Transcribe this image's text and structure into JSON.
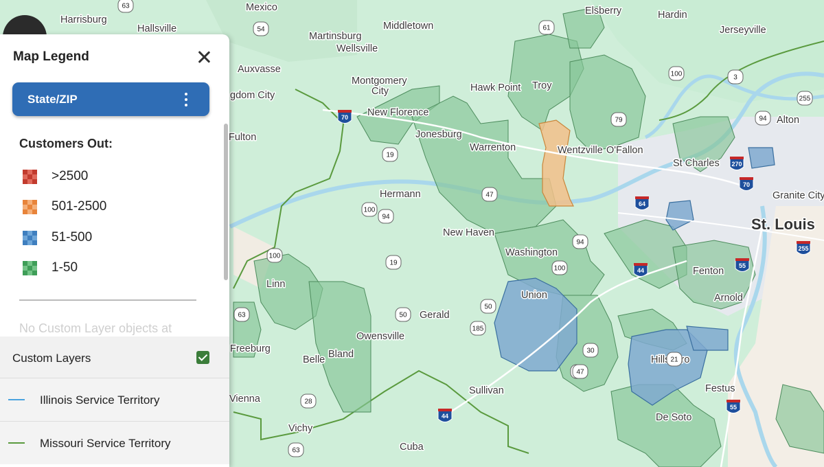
{
  "map": {
    "places": [
      {
        "name": "Harrisburg"
      },
      {
        "name": "Hallsville"
      },
      {
        "name": "Mexico"
      },
      {
        "name": "Middletown"
      },
      {
        "name": "Elsberry"
      },
      {
        "name": "Hardin"
      },
      {
        "name": "Jerseyville"
      },
      {
        "name": "Martinsburg"
      },
      {
        "name": "Wellsville"
      },
      {
        "name": "Auxvasse"
      },
      {
        "name": "Montgomery"
      },
      {
        "name": "City"
      },
      {
        "name": "Hawk Point"
      },
      {
        "name": "Troy"
      },
      {
        "name": "gdom City"
      },
      {
        "name": "New Florence"
      },
      {
        "name": "Jonesburg"
      },
      {
        "name": "Warrenton"
      },
      {
        "name": "Wentzville"
      },
      {
        "name": "O'Fallon"
      },
      {
        "name": "Alton"
      },
      {
        "name": "Fulton"
      },
      {
        "name": "St Charles"
      },
      {
        "name": "Hermann"
      },
      {
        "name": "Granite City"
      },
      {
        "name": "New Haven"
      },
      {
        "name": "St. Louis"
      },
      {
        "name": "Washington"
      },
      {
        "name": "Linn"
      },
      {
        "name": "Fenton"
      },
      {
        "name": "Union"
      },
      {
        "name": "Arnold"
      },
      {
        "name": "Gerald"
      },
      {
        "name": "Owensville"
      },
      {
        "name": "Freeburg"
      },
      {
        "name": "Belle"
      },
      {
        "name": "Bland"
      },
      {
        "name": "Hillsboro"
      },
      {
        "name": "Sullivan"
      },
      {
        "name": "Festus"
      },
      {
        "name": "Vienna"
      },
      {
        "name": "De Soto"
      },
      {
        "name": "Vichy"
      },
      {
        "name": "Cuba"
      }
    ],
    "shields": [
      {
        "num": "63"
      },
      {
        "num": "54"
      },
      {
        "num": "61"
      },
      {
        "num": "79"
      },
      {
        "num": "100"
      },
      {
        "num": "3"
      },
      {
        "num": "255"
      },
      {
        "num": "19"
      },
      {
        "num": "94"
      },
      {
        "num": "47"
      },
      {
        "num": "100"
      },
      {
        "num": "94"
      },
      {
        "num": "100"
      },
      {
        "num": "19"
      },
      {
        "num": "100"
      },
      {
        "num": "63"
      },
      {
        "num": "50"
      },
      {
        "num": "50"
      },
      {
        "num": "185"
      },
      {
        "num": "30"
      },
      {
        "num": "47"
      },
      {
        "num": "21"
      },
      {
        "num": "28"
      },
      {
        "num": "63"
      },
      {
        "num": "94"
      },
      {
        "num": "47"
      }
    ],
    "interstates": [
      {
        "num": "70"
      },
      {
        "num": "64"
      },
      {
        "num": "270"
      },
      {
        "num": "70"
      },
      {
        "num": "255"
      },
      {
        "num": "44"
      },
      {
        "num": "55"
      },
      {
        "num": "55"
      },
      {
        "num": "44"
      }
    ]
  },
  "legend": {
    "title": "Map Legend",
    "layer_button": "State/ZIP",
    "section_title": "Customers Out:",
    "items": [
      {
        "label": ">2500",
        "color": "#c23b2e",
        "color2": "#e06a5c"
      },
      {
        "label": "501-2500",
        "color": "#e8843a",
        "color2": "#f4b07a"
      },
      {
        "label": "51-500",
        "color": "#3f7fbf",
        "color2": "#6ea6d9"
      },
      {
        "label": "1-50",
        "color": "#3f9e58",
        "color2": "#74c488"
      }
    ],
    "faded_text": "No Custom Layer objects at",
    "custom_layers_label": "Custom Layers",
    "custom_layers_checked": true,
    "layers": [
      {
        "label": "Illinois Service Territory",
        "color": "#4aa3df"
      },
      {
        "label": "Missouri Service Territory",
        "color": "#5a9a3e"
      }
    ]
  }
}
